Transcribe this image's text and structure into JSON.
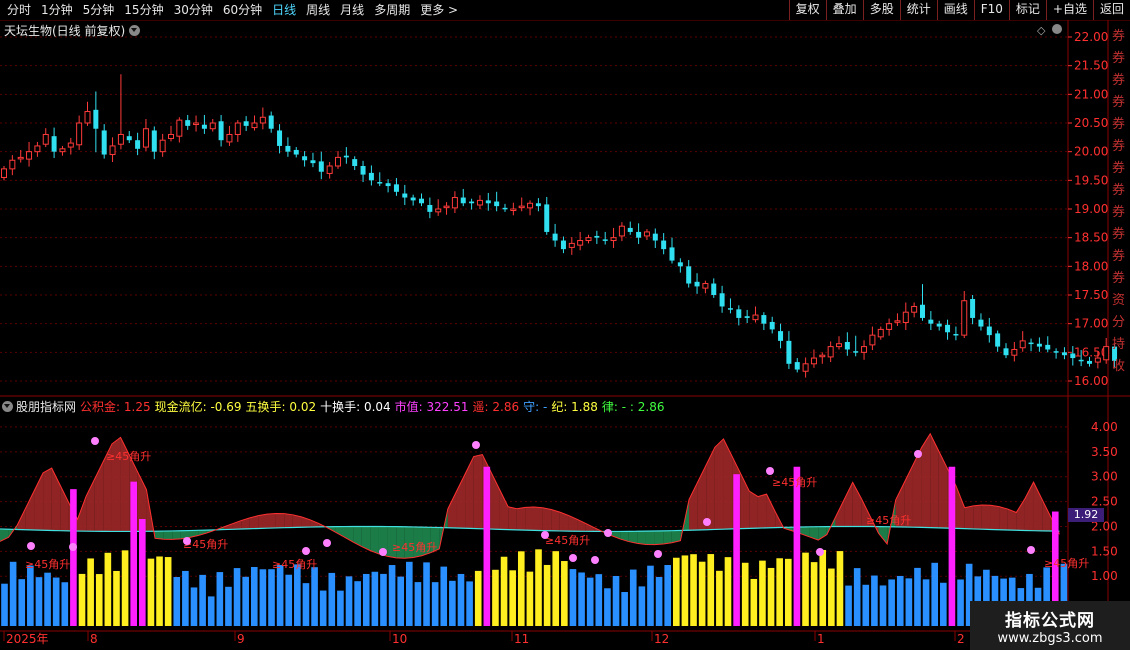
{
  "toolbar": {
    "left": [
      "分时",
      "1分钟",
      "5分钟",
      "15分钟",
      "30分钟",
      "60分钟",
      "日线",
      "周线",
      "月线",
      "多周期",
      "更多 >"
    ],
    "active": "日线",
    "right": [
      "复权",
      "叠加",
      "多股",
      "统计",
      "画线",
      "F10",
      "标记",
      "+自选",
      "返回"
    ]
  },
  "main_title": "天坛生物(日线 前复权)",
  "indicator": {
    "name": "股朋指标网",
    "items": [
      {
        "label": "公积金: 1.25",
        "color": "#ff3030"
      },
      {
        "label": "现金流亿: -0.69",
        "color": "#ffff40"
      },
      {
        "label": "五换手: 0.02",
        "color": "#ffff40"
      },
      {
        "label": "十换手: 0.04",
        "color": "#ffffff"
      },
      {
        "label": "市值: 322.51",
        "color": "#ff40ff"
      },
      {
        "label": "遥: 2.86",
        "color": "#ff3030"
      },
      {
        "label": "守: -",
        "color": "#40a0ff"
      },
      {
        "label": "纪: 1.88",
        "color": "#ffff40"
      },
      {
        "label": "律: - : 2.86",
        "color": "#40ff40"
      }
    ],
    "current_value": "1.92"
  },
  "right_strip_text": [
    "券",
    "券",
    "券",
    "券",
    "券",
    "券",
    "券",
    "券",
    "券",
    "券",
    "券",
    "券",
    "资",
    "分",
    "持",
    "收"
  ],
  "watermark": {
    "line1": "指标公式网",
    "line2": "www.zbgs3.com"
  },
  "colors": {
    "up": "#ff3a3a",
    "down": "#30e0f0",
    "axis": "#ff3030",
    "grid": "#5a0000"
  },
  "chart_data": [
    {
      "type": "candlestick",
      "title": "天坛生物(日线 前复权)",
      "ylim": [
        16.0,
        22.0
      ],
      "yticks": [
        "22.00",
        "21.50",
        "21.00",
        "20.50",
        "20.00",
        "19.50",
        "19.00",
        "18.50",
        "18.00",
        "17.50",
        "17.00",
        "16.50",
        "16.00"
      ],
      "close": [
        19.7,
        19.85,
        19.9,
        20.0,
        20.1,
        20.3,
        20.0,
        20.05,
        20.15,
        20.5,
        20.7,
        20.4,
        19.95,
        20.1,
        20.3,
        20.2,
        20.05,
        20.4,
        20.0,
        20.2,
        20.3,
        20.55,
        20.45,
        20.5,
        20.4,
        20.5,
        20.2,
        20.3,
        20.5,
        20.45,
        20.5,
        20.6,
        20.4,
        20.1,
        20.0,
        19.95,
        19.85,
        19.8,
        19.65,
        19.75,
        19.9,
        19.9,
        19.75,
        19.6,
        19.5,
        19.45,
        19.4,
        19.3,
        19.2,
        19.15,
        19.1,
        18.95,
        19.0,
        19.05,
        19.2,
        19.1,
        19.1,
        19.15,
        19.1,
        19.05,
        19.0,
        19.0,
        19.05,
        19.1,
        19.05,
        18.6,
        18.45,
        18.3,
        18.4,
        18.45,
        18.5,
        18.5,
        18.45,
        18.5,
        18.7,
        18.6,
        18.5,
        18.6,
        18.45,
        18.3,
        18.1,
        18.0,
        17.7,
        17.65,
        17.7,
        17.5,
        17.3,
        17.25,
        17.1,
        17.1,
        17.15,
        17.0,
        16.9,
        16.7,
        16.3,
        16.2,
        16.3,
        16.4,
        16.45,
        16.6,
        16.65,
        16.55,
        16.5,
        16.6,
        16.8,
        16.9,
        17.0,
        17.05,
        17.2,
        17.3,
        17.1,
        17.0,
        16.95,
        16.85,
        16.8,
        17.4,
        17.1,
        16.95,
        16.8,
        16.6,
        16.45,
        16.55,
        16.7,
        16.65,
        16.6,
        16.55,
        16.5,
        16.45,
        16.4,
        16.35,
        16.3,
        16.4,
        16.6,
        16.35
      ],
      "volume_bars": 124
    },
    {
      "type": "bar",
      "title": "股朋指标网",
      "ylim": [
        0.0,
        4.3
      ],
      "yticks": [
        "4.00",
        "3.50",
        "3.00",
        "2.50",
        "2.00",
        "1.50",
        "1.00"
      ],
      "x_labels": [
        "2025年",
        "8",
        "9",
        "10",
        "11",
        "12",
        "1",
        "2"
      ],
      "annotation": "≥45角升",
      "series_colors": [
        "#2a90ff",
        "#ffee20",
        "#ff20ff"
      ]
    }
  ]
}
